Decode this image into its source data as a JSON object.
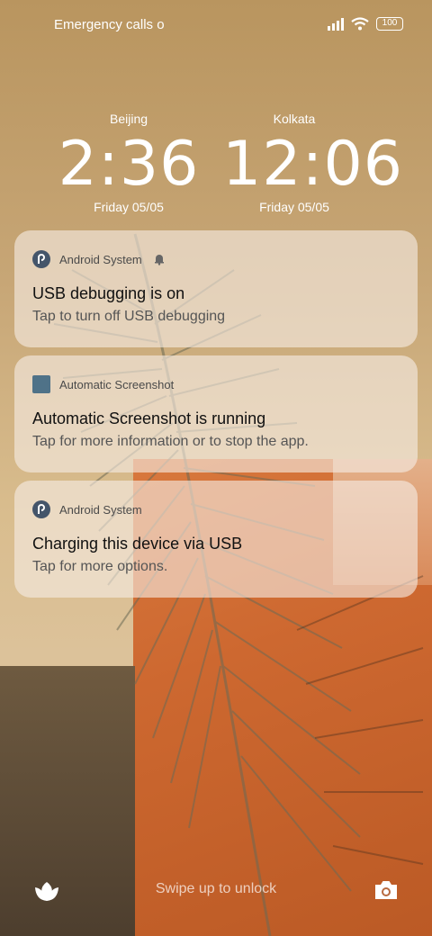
{
  "status_bar": {
    "carrier_text": "Emergency calls o",
    "battery": "100"
  },
  "clocks": [
    {
      "city": "Beijing",
      "time": "2:36",
      "date": "Friday 05/05"
    },
    {
      "city": "Kolkata",
      "time": "12:06",
      "date": "Friday 05/05"
    }
  ],
  "notifications": [
    {
      "app": "Android System",
      "icon": "android-system-icon",
      "title": "USB debugging is on",
      "text": "Tap to turn off USB debugging"
    },
    {
      "app": "Automatic Screenshot",
      "icon": "app-square-icon",
      "title": "Automatic Screenshot is running",
      "text": "Tap for more information or to stop the app."
    },
    {
      "app": "Android System",
      "icon": "android-system-icon",
      "title": "Charging this device via USB",
      "text": "Tap for more options."
    }
  ],
  "bottom": {
    "hint": "Swipe up to unlock",
    "left_icon": "tulip-icon",
    "right_icon": "camera-icon"
  },
  "colors": {
    "wallpaper_top": "#b9955f",
    "wallpaper_orange": "#cd6830",
    "notification_bg": "#f5ece4"
  }
}
